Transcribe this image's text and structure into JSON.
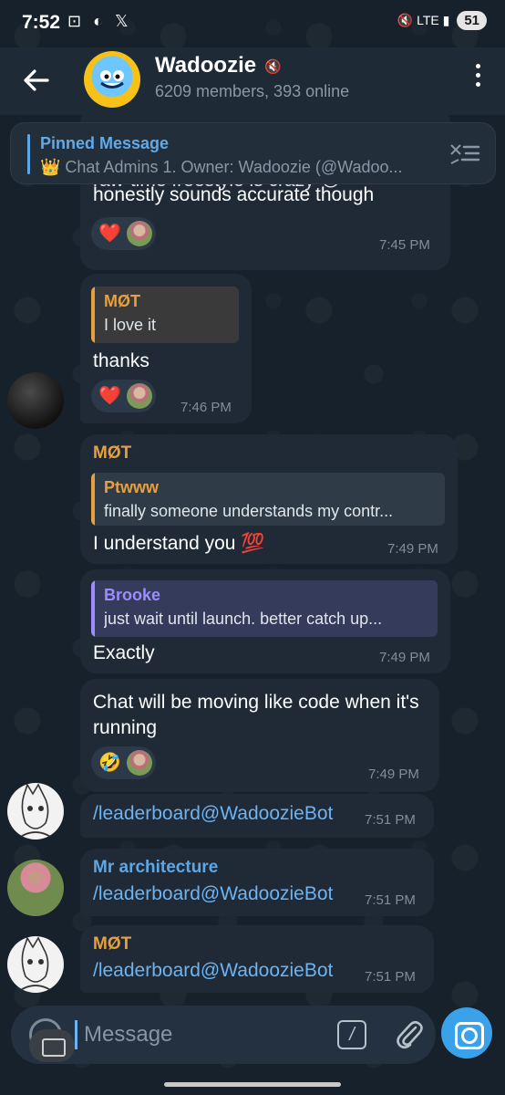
{
  "status_bar": {
    "time": "7:52",
    "left_icons": "⊡ ◐ 𝕏",
    "right_icons": "🔇 LTE ▮",
    "battery": "51"
  },
  "header": {
    "title": "Wadoozie",
    "subtitle": "6209 members, 393 online"
  },
  "pinned": {
    "title": "Pinned Message",
    "text": "👑 Chat Admins  1. Owner: Wadoozie (@Wadoo..."
  },
  "messages": [
    {
      "partial_text_top": "raw-time freestyle is crazy 😭",
      "text": "honestly sounds accurate though",
      "reaction": "❤️",
      "time": "7:45 PM"
    },
    {
      "quote_name": "MØT",
      "quote_text": "I love it",
      "text": "thanks",
      "reaction": "❤️",
      "time": "7:46 PM"
    },
    {
      "sender": "MØT",
      "quote_name": "Ptwww",
      "quote_text": "finally someone understands my contr...",
      "text": "I understand you 💯",
      "time": "7:49 PM"
    },
    {
      "quote_name": "Brooke",
      "quote_text": "just wait until launch. better catch up...",
      "text": "Exactly",
      "time": "7:49 PM"
    },
    {
      "text": "Chat will be moving like code when it's running",
      "reaction": "🤣",
      "time": "7:49 PM"
    },
    {
      "text": "/leaderboard@WadoozieBot",
      "time": "7:51 PM"
    },
    {
      "sender": "Mr architecture",
      "text": "/leaderboard@WadoozieBot",
      "time": "7:51 PM"
    },
    {
      "sender": "MØT",
      "text": "/leaderboard@WadoozieBot",
      "time": "7:51 PM"
    }
  ],
  "input": {
    "placeholder": "Message",
    "cmd_label": "/"
  },
  "colors": {
    "accent": "#6db3f2",
    "mot_orange": "#e8a03c",
    "brooke_purple": "#9c8cff",
    "architecture_blue": "#5ea7e6"
  }
}
